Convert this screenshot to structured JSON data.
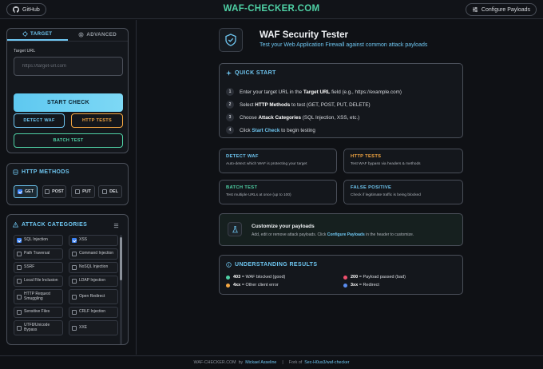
{
  "header": {
    "github_label": "GitHub",
    "brand": "WAF-CHECKER.COM",
    "configure_label": "Configure Payloads"
  },
  "sidebar": {
    "tabs": [
      {
        "label": "TARGET",
        "active": true
      },
      {
        "label": "ADVANCED",
        "active": false
      }
    ],
    "target_url_label": "Target URL",
    "target_url_placeholder": "https://target-url.com",
    "target_url_value": "",
    "start_check_label": "START CHECK",
    "detect_waf_label": "DETECT WAF",
    "http_tests_label": "HTTP TESTS",
    "batch_test_label": "BATCH TEST",
    "http_methods_title": "HTTP METHODS",
    "methods": [
      {
        "label": "GET",
        "checked": true
      },
      {
        "label": "POST",
        "checked": false
      },
      {
        "label": "PUT",
        "checked": false
      },
      {
        "label": "DEL",
        "checked": false
      }
    ],
    "attack_categories_title": "ATTACK CATEGORIES",
    "categories": [
      {
        "label": "SQL Injection",
        "checked": true
      },
      {
        "label": "XSS",
        "checked": true
      },
      {
        "label": "Path Traversal",
        "checked": false
      },
      {
        "label": "Command Injection",
        "checked": false
      },
      {
        "label": "SSRF",
        "checked": false
      },
      {
        "label": "NoSQL Injection",
        "checked": false
      },
      {
        "label": "Local File Inclusion",
        "checked": false
      },
      {
        "label": "LDAP Injection",
        "checked": false
      },
      {
        "label": "HTTP Request Smuggling",
        "checked": false
      },
      {
        "label": "Open Redirect",
        "checked": false
      },
      {
        "label": "Sensitive Files",
        "checked": false
      },
      {
        "label": "CRLF Injection",
        "checked": false
      },
      {
        "label": "UTF8/Unicode Bypass",
        "checked": false
      },
      {
        "label": "XXE",
        "checked": false
      }
    ]
  },
  "main": {
    "title": "WAF Security Tester",
    "subtitle": "Test your Web Application Firewall against common attack payloads",
    "quick_start": {
      "title": "QUICK START",
      "steps": [
        {
          "n": "1",
          "pre": "Enter your target URL in the ",
          "em": "Target URL",
          "post": " field (e.g., https://example.com)"
        },
        {
          "n": "2",
          "pre": "Select ",
          "em": "HTTP Methods",
          "post": " to test (GET, POST, PUT, DELETE)"
        },
        {
          "n": "3",
          "pre": "Choose ",
          "em": "Attack Categories",
          "post": " (SQL Injection, XSS, etc.)"
        },
        {
          "n": "4",
          "pre": "Click ",
          "em": "Start Check",
          "post": " to begin testing"
        }
      ]
    },
    "features": [
      {
        "title": "DETECT WAF",
        "desc": "Auto-detect which WAF is protecting your target",
        "color": "#6fc7f2"
      },
      {
        "title": "HTTP TESTS",
        "desc": "Test WAF bypass via headers & methods",
        "color": "#f5a742"
      },
      {
        "title": "BATCH TEST",
        "desc": "Test multiple URLs at once (up to 100)",
        "color": "#4fd1a5"
      },
      {
        "title": "FALSE POSITIVE",
        "desc": "Check if legitimate traffic is being blocked",
        "color": "#6fc7f2"
      }
    ],
    "customize": {
      "title": "Customize your payloads",
      "desc_pre": "Add, edit or remove attack payloads. Click ",
      "desc_link": "Configure Payloads",
      "desc_post": " in the header to customize."
    },
    "results": {
      "title": "UNDERSTANDING RESULTS",
      "items": [
        {
          "code": "403",
          "text": " = WAF blocked (good)",
          "color": "#4fd1a5"
        },
        {
          "code": "200",
          "text": " = Payload passed (bad)",
          "color": "#f0506e"
        },
        {
          "code": "4xx",
          "text": " = Other client error",
          "color": "#f5a742"
        },
        {
          "code": "3xx",
          "text": " = Redirect",
          "color": "#5b8def"
        }
      ]
    }
  },
  "footer": {
    "brand": "WAF-CHECKER.COM",
    "by": "by",
    "author": "Mickael Asseline",
    "sep": "|",
    "fork_text": "Fork of",
    "fork_link": "Sec-H0us3/waf-checker"
  }
}
